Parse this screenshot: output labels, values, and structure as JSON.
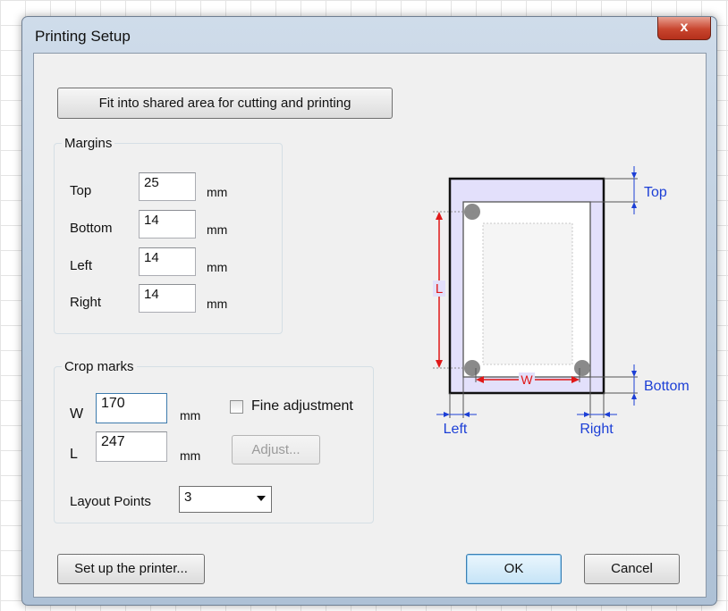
{
  "window": {
    "title": "Printing Setup",
    "close_label": "x"
  },
  "fit_button": "Fit into shared area for cutting and printing",
  "margins": {
    "group_label": "Margins",
    "unit": "mm",
    "top": {
      "label": "Top",
      "value": "25"
    },
    "bottom": {
      "label": "Bottom",
      "value": "14"
    },
    "left": {
      "label": "Left",
      "value": "14"
    },
    "right": {
      "label": "Right",
      "value": "14"
    }
  },
  "crop_marks": {
    "group_label": "Crop marks",
    "unit": "mm",
    "w": {
      "label": "W",
      "value": "170"
    },
    "l": {
      "label": "L",
      "value": "247"
    },
    "fine_adjustment": {
      "label": "Fine adjustment",
      "checked": false
    },
    "adjust_button": "Adjust...",
    "layout_points": {
      "label": "Layout Points",
      "value": "3"
    }
  },
  "diagram": {
    "top": "Top",
    "bottom": "Bottom",
    "left": "Left",
    "right": "Right",
    "w": "W",
    "l": "L",
    "colors": {
      "dimension": "#1c3fd6",
      "crop": "#e01818",
      "paper_fill": "#e3e0fb"
    }
  },
  "buttons": {
    "printer": "Set up the printer...",
    "ok": "OK",
    "cancel": "Cancel"
  }
}
